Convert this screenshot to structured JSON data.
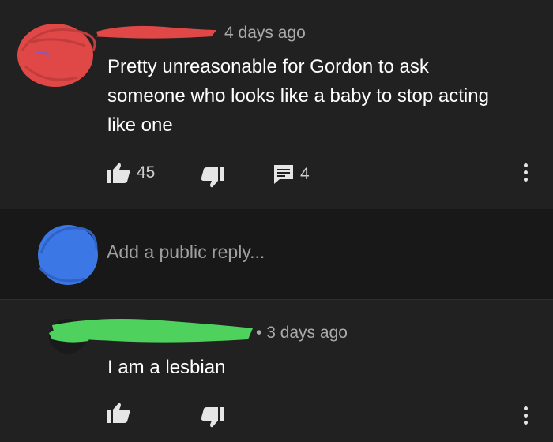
{
  "comment": {
    "timestamp": "4 days ago",
    "text_lines": [
      "Pretty unreasonable for Gordon to ask",
      "someone who looks like a baby to stop acting",
      "like one"
    ],
    "likes": "45",
    "replies": "4",
    "redaction_color": "#e04848"
  },
  "reply_box": {
    "placeholder": "Add a public reply...",
    "redaction_color": "#3b78e6"
  },
  "reply": {
    "timestamp": "3 days ago",
    "text": "I am a lesbian",
    "redaction_color": "#4fd15e"
  },
  "icons": {
    "like": "thumbs-up-icon",
    "dislike": "thumbs-down-icon",
    "reply": "comment-icon",
    "menu": "more-vert-icon"
  }
}
